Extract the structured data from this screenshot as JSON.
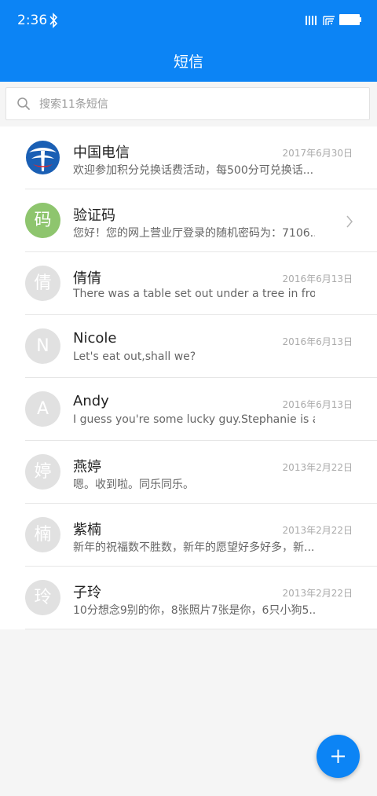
{
  "status_bar": {
    "time": "2:36",
    "icons": [
      "bluetooth-icon",
      "signal-icon",
      "wifi-icon",
      "battery-icon"
    ]
  },
  "header": {
    "title": "短信",
    "color": "#0c84f5"
  },
  "search": {
    "placeholder": "搜索11条短信",
    "value": ""
  },
  "conversations": [
    {
      "avatar": "china-telecom-logo",
      "name": "中国电信",
      "date": "2017年6月30日",
      "preview": "欢迎参加积分兑换话费活动，每500分可兑换话..."
    },
    {
      "avatar": "码",
      "name": "验证码",
      "date": "",
      "preview": "您好！您的网上营业厅登录的随机密码为：7106...",
      "chevron": true
    },
    {
      "avatar": "倩",
      "name": "倩倩",
      "date": "2016年6月13日",
      "preview": "There was a table set out under a tree in fron..."
    },
    {
      "avatar": "N",
      "name": "Nicole",
      "date": "2016年6月13日",
      "preview": "Let's eat out,shall we?"
    },
    {
      "avatar": "A",
      "name": "Andy",
      "date": "2016年6月13日",
      "preview": "I guess you're some lucky guy.Stephanie is a..."
    },
    {
      "avatar": "婷",
      "name": "燕婷",
      "date": "2013年2月22日",
      "preview": "嗯。收到啦。同乐同乐。"
    },
    {
      "avatar": "楠",
      "name": "紫楠",
      "date": "2013年2月22日",
      "preview": "新年的祝福数不胜数，新年的愿望好多好多，新..."
    },
    {
      "avatar": "玲",
      "name": "子玲",
      "date": "2013年2月22日",
      "preview": "10分想念9别的你，8张照片7张是你，6只小狗5..."
    }
  ],
  "fab": {
    "icon": "plus-icon"
  }
}
